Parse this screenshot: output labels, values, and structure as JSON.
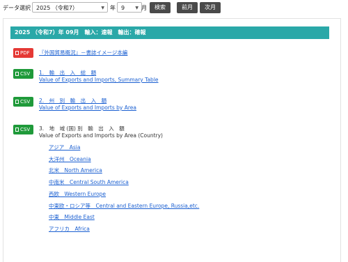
{
  "toolbar": {
    "data_select_label": "データ選択",
    "year_value": "2025 （令和7）",
    "year_unit": "年",
    "month_value": "9",
    "month_unit": "月",
    "search_button": "検索",
    "prev_month_button": "前月",
    "next_month_button": "次月"
  },
  "header": {
    "title": "2025 （令和7）年 09月　輸入：速報　輸出：確報"
  },
  "items": [
    {
      "badge": "PDF",
      "link": "『外国貿易概況』－書誌イメージ本編"
    },
    {
      "badge": "CSV",
      "title_ja": "1.　輸　出　入　総　額",
      "title_en": "Value of Exports and Imports, Summary Table"
    },
    {
      "badge": "CSV",
      "title_ja": "2.　州　別　輸　出　入　額",
      "title_en": "Value of Exports and Imports by Area"
    },
    {
      "badge": "CSV",
      "title_ja": "3.　地　域 (国) 別　輸　出　入　額",
      "title_en": "Value of Exports and Imports by Area (Country)"
    }
  ],
  "regions": [
    "アジア　Asia",
    "大洋州　Oceania",
    "北米　North America",
    "中南米　Central South America",
    "西欧　Western Europe",
    "中東欧・ロシア等　Central and Eastern Europe, Russia,etc.",
    "中東　Middle East",
    "アフリカ　Africa"
  ],
  "colors": {
    "header_bg": "#2aa8a8",
    "pdf_badge": "#e53935",
    "csv_badge": "#1f9a3a",
    "link": "#1a5fd1",
    "button_bg": "#4a4a4a"
  }
}
